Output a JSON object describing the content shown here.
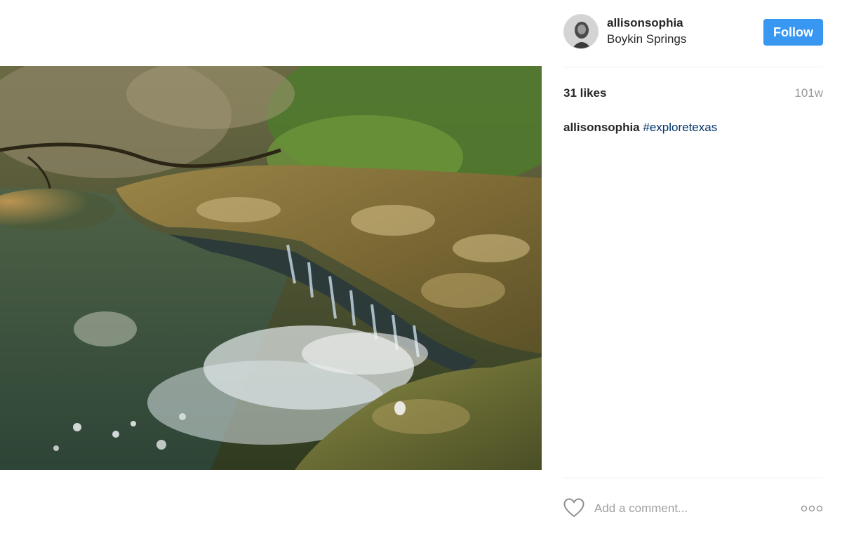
{
  "post": {
    "image_subject": "waterfall-photo",
    "author": {
      "username": "allisonsophia",
      "location": "Boykin Springs",
      "follow_label": "Follow"
    },
    "likes_text": "31 likes",
    "age_text": "101w",
    "caption": {
      "username": "allisonsophia",
      "hashtag": "#exploretexas"
    },
    "comment": {
      "placeholder": "Add a comment..."
    },
    "icons": {
      "like": "heart-icon",
      "more": "more-options-icon"
    }
  },
  "colors": {
    "follow_button": "#3897f0",
    "hashtag": "#003569",
    "muted_text": "#999999",
    "divider": "#efefef"
  }
}
